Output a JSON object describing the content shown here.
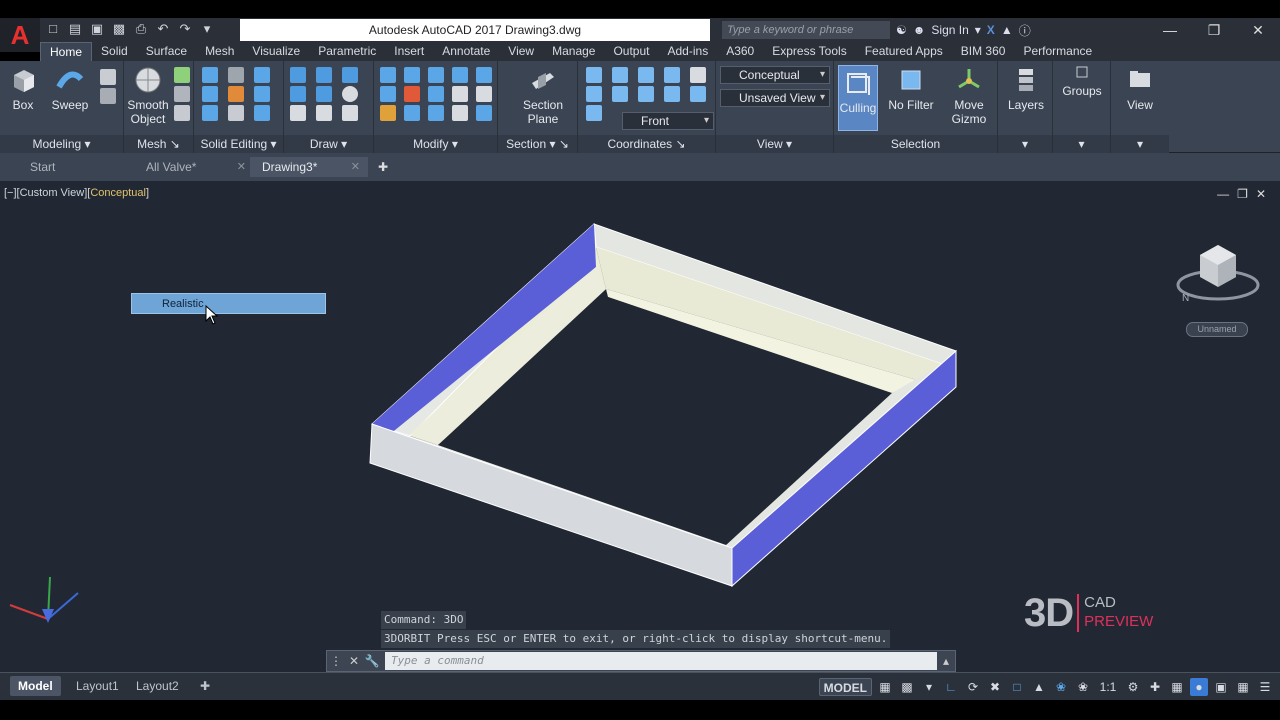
{
  "app": {
    "logo": "A",
    "title": "Autodesk AutoCAD 2017    Drawing3.dwg",
    "search_placeholder": "Type a keyword or phrase",
    "sign_in": "Sign In"
  },
  "ribbon_tabs": [
    "Home",
    "Solid",
    "Surface",
    "Mesh",
    "Visualize",
    "Parametric",
    "Insert",
    "Annotate",
    "View",
    "Manage",
    "Output",
    "Add-ins",
    "A360",
    "Express Tools",
    "Featured Apps",
    "BIM 360",
    "Performance"
  ],
  "ribbon": {
    "modeling": {
      "title": "Modeling",
      "box": "Box",
      "sweep": "Sweep",
      "smooth_object_1": "Smooth",
      "smooth_object_2": "Object"
    },
    "mesh": {
      "title": "Mesh"
    },
    "solid_editing": {
      "title": "Solid Editing"
    },
    "draw": {
      "title": "Draw"
    },
    "modify": {
      "title": "Modify"
    },
    "section": {
      "title": "Section",
      "section_plane_1": "Section",
      "section_plane_2": "Plane"
    },
    "coordinates": {
      "title": "Coordinates"
    },
    "view": {
      "title": "View",
      "visual_style": "Conceptual",
      "named_view": "Unsaved View",
      "orientation": "Front"
    },
    "selection": {
      "title": "Selection",
      "culling": "Culling",
      "no_filter": "No Filter",
      "move_gizmo_1": "Move",
      "move_gizmo_2": "Gizmo"
    },
    "layers": {
      "label": "Layers"
    },
    "groups": {
      "label": "Groups"
    },
    "view_btn": {
      "label": "View"
    }
  },
  "file_tabs": [
    {
      "label": "Start"
    },
    {
      "label": "All Valve*"
    },
    {
      "label": "Drawing3*"
    }
  ],
  "viewport": {
    "label_prefix": "[−][Custom View][",
    "visual_style": "Conceptual",
    "label_suffix": "]",
    "context_item": "Realistic",
    "viewcube_name": "Unnamed"
  },
  "command": {
    "history": [
      "Command: 3DO",
      "3DORBIT Press ESC or ENTER to exit, or right-click to display shortcut-menu."
    ],
    "placeholder": "Type a command"
  },
  "brand": {
    "main": "3D",
    "line1": "CAD",
    "line2": "PREVIEW"
  },
  "status": {
    "layout_tabs": [
      "Model",
      "Layout1",
      "Layout2"
    ],
    "model_label": "MODEL",
    "scale": "1:1"
  },
  "colors": {
    "background": "#212833",
    "accent_blue": "#5a5fd8",
    "ribbon": "#3b4453",
    "brand_pink": "#e0305a"
  }
}
